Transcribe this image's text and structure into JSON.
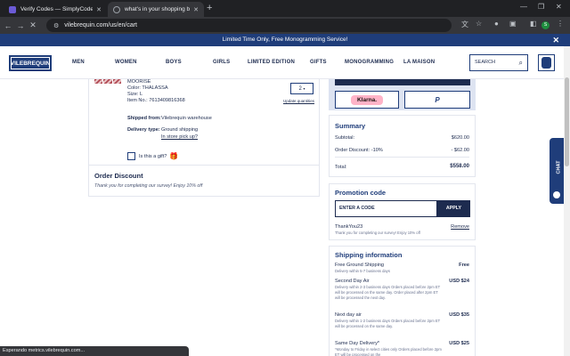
{
  "browser": {
    "tabs": [
      {
        "title": "Verify Codes — SimplyCodes",
        "favicon_color": "#6b5bd6"
      },
      {
        "title": "what's in your shopping bag",
        "favicon_color": "#9aa0a6"
      }
    ],
    "url": "vilebrequin.com/us/en/cart",
    "status_text": "Esperando metrics.vilebrequin.com..."
  },
  "promo": {
    "text": "Limited Time Only, Free Monogramming Service!"
  },
  "header": {
    "logo": "VILEBREQUIN",
    "nav": [
      "MEN",
      "WOMEN",
      "BOYS",
      "GIRLS",
      "LIMITED EDITION",
      "GIFTS",
      "MONOGRAMMING",
      "LA MAISON"
    ],
    "search_placeholder": "SEARCH"
  },
  "product": {
    "name": "MOORISE",
    "color": "Color: THALASSA",
    "size": "Size: L",
    "item_no": "Item No.: 7613409816368",
    "quantity": "2",
    "update_label": "Update quantities",
    "shipped_from_label": "Shipped from:",
    "shipped_from_value": "Vilebrequin warehouse",
    "delivery_label": "Delivery type:",
    "delivery_value": "Ground shipping",
    "pickup_link": "In store pick up?",
    "gift_label": "Is this a gift?"
  },
  "order_discount": {
    "title": "Order Discount",
    "message": "Thank you for completing our survey! Enjoy 10% off"
  },
  "payment": {
    "klarna": "Klarna.",
    "paypal": "P"
  },
  "summary": {
    "title": "Summary",
    "rows": [
      {
        "label": "Subtotal:",
        "value": "$620.00"
      },
      {
        "label": "Order Discount: -10%",
        "value": "- $62.00"
      }
    ],
    "total_label": "Total:",
    "total_value": "$558.00"
  },
  "promotion": {
    "title": "Promotion code",
    "input_placeholder": "ENTER A CODE",
    "apply_label": "APPLY",
    "code": "ThankYou23",
    "code_note": "Thank you for completing our survey! Enjoy 10% off",
    "remove_label": "Remove"
  },
  "shipping": {
    "title": "Shipping information",
    "options": [
      {
        "name": "Free Ground Shipping",
        "price": "Free",
        "desc": "Delivery within 5-7 business days"
      },
      {
        "name": "Second Day Air",
        "price": "USD $24",
        "desc": "Delivery within 2-3 business days Orders placed before 2pm ET will be processed on the same day. Order placed after 2pm ET will be processed the next day."
      },
      {
        "name": "Next day air",
        "price": "USD $35",
        "desc": "Delivery within 1-2 business days Orders placed before 2pm ET will be processed on the same day."
      },
      {
        "name": "Same Day Delivery*",
        "price": "USD $25",
        "desc": "*Monday to Friday in select cities only Orders placed before 2pm ET will be processed on the"
      }
    ]
  },
  "chat": {
    "label": "CHAT"
  }
}
